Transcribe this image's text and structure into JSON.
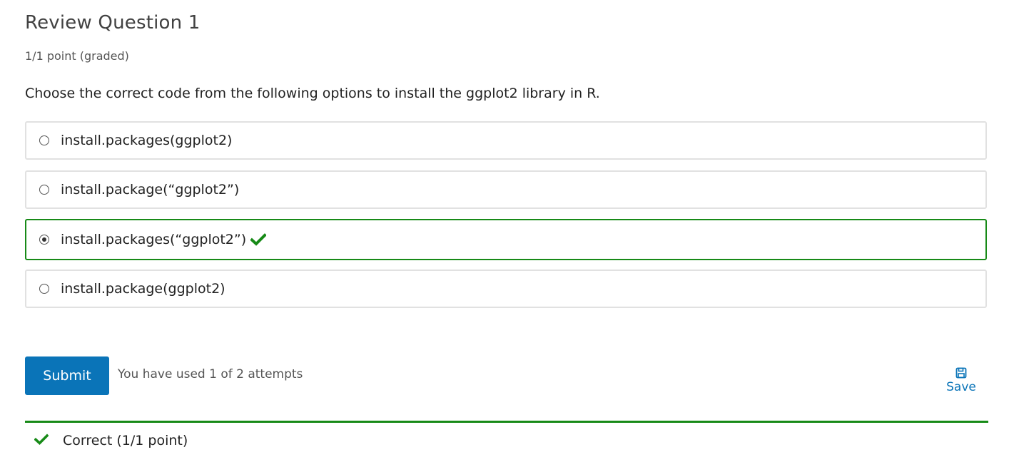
{
  "question": {
    "title": "Review Question 1",
    "points": "1/1 point (graded)",
    "prompt": "Choose the correct code from the following options to install the ggplot2 library in R."
  },
  "options": [
    {
      "label": "install.packages(ggplot2)",
      "selected": false,
      "correct": false
    },
    {
      "label": "install.package(“ggplot2”)",
      "selected": false,
      "correct": false
    },
    {
      "label": "install.packages(“ggplot2”)",
      "selected": true,
      "correct": true
    },
    {
      "label": "install.package(ggplot2)",
      "selected": false,
      "correct": false
    }
  ],
  "actions": {
    "submit_label": "Submit",
    "attempts_text": "You have used 1 of 2 attempts",
    "save_label": "Save"
  },
  "result": {
    "label": "Correct (1/1 point)"
  },
  "icons": {
    "correct": "check-icon",
    "save": "save-icon"
  },
  "colors": {
    "accent": "#0a74b8",
    "correct": "#178a17"
  }
}
